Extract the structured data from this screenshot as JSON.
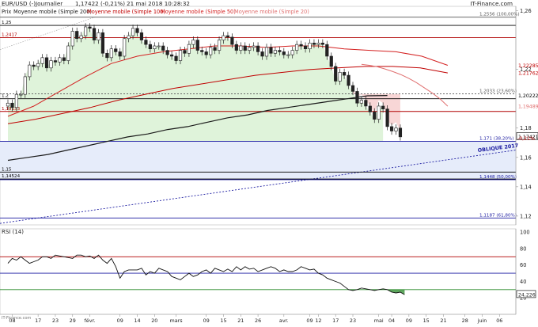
{
  "header": {
    "title": "EUR/USD (-)",
    "period": "Journalier",
    "last_change": "1,17422 (-0,21%)",
    "datetime": "21 mai 2018 10:28:32",
    "source": "IT-Finance.com"
  },
  "legend": [
    {
      "label": "Prix",
      "color": "#222222"
    },
    {
      "label": "Moyenne mobile (Simple 200)",
      "color": "#1a1a1a"
    },
    {
      "label": "Moyenne mobile (Simple 100)",
      "color": "#c00000"
    },
    {
      "label": "Moyenne mobile (Simple 50)",
      "color": "#d42020"
    },
    {
      "label": "Moyenne mobile (Simple 20)",
      "color": "#e07070"
    }
  ],
  "price_axis": {
    "ticks": [
      "1,26",
      "1,22",
      "1,18",
      "1,16",
      "1,14",
      "1,12"
    ],
    "tick_values": [
      1.26,
      1.22,
      1.18,
      1.16,
      1.14,
      1.12
    ],
    "range": [
      1.114,
      1.263
    ]
  },
  "rsi_axis": {
    "ticks": [
      "100",
      "80",
      "60",
      "40",
      "20"
    ],
    "tick_values": [
      100,
      80,
      60,
      40,
      20
    ],
    "range": [
      0,
      104
    ]
  },
  "x_axis": {
    "ticks": [
      "08",
      "17",
      "23",
      "29",
      "févr.",
      "09",
      "14",
      "20",
      "mars",
      "09",
      "15",
      "21",
      "26",
      "avr.",
      "09",
      "12",
      "17",
      "23",
      "mai",
      "04",
      "09",
      "15",
      "21",
      "28",
      "juin",
      "06"
    ],
    "tick_index": [
      1,
      7,
      11,
      15,
      19,
      26,
      30,
      34,
      39,
      46,
      50,
      54,
      58,
      64,
      70,
      72,
      76,
      80,
      86,
      89,
      93,
      97,
      101,
      106,
      110,
      114
    ]
  },
  "horizontal_levels": [
    {
      "value": 1.25,
      "label": "1,25",
      "color": "#000000",
      "side": "left"
    },
    {
      "value": 1.2556,
      "label": "1,2556 (100,00%)",
      "color": "#555555",
      "side": "right"
    },
    {
      "value": 1.2417,
      "label": "1,2417",
      "color": "#b00000",
      "side": "left"
    },
    {
      "value": 1.2033,
      "label": "1,2033 (23,60%)",
      "color": "#555555",
      "side": "right",
      "dashed": true
    },
    {
      "value": 1.2,
      "label": "1,2",
      "color": "#000000",
      "side": "left"
    },
    {
      "value": 1.19133,
      "label": "1,19133",
      "color": "#b00000",
      "side": "left"
    },
    {
      "value": 1.171,
      "label": "1,171 (38,20%)",
      "color": "#1a1aa0",
      "side": "right"
    },
    {
      "value": 1.15,
      "label": "1,15",
      "color": "#000000",
      "side": "left"
    },
    {
      "value": 1.14524,
      "label": "1,14524",
      "color": "#000000",
      "side": "left"
    },
    {
      "value": 1.1448,
      "label": "1,1448 (50,00%)",
      "color": "#1a1aa0",
      "side": "right"
    },
    {
      "value": 1.1187,
      "label": "1,1187 (61,80%)",
      "color": "#1a1aa0",
      "side": "right"
    }
  ],
  "value_badges": [
    {
      "value": 1.22285,
      "label": "1,22285",
      "color": "#c00000"
    },
    {
      "value": 1.21762,
      "label": "1,21762",
      "color": "#c00000"
    },
    {
      "value": 1.20222,
      "label": "1,20222",
      "color": "#000000"
    },
    {
      "value": 1.19489,
      "label": "1,19489",
      "color": "#e07070"
    },
    {
      "value": 1.17421,
      "label": "1,17421",
      "color": "#000000",
      "boxed": true
    }
  ],
  "change_label": "-0,21%",
  "oblique_label": "OBLIQUE 2017",
  "rsi": {
    "title": "RSI (14)",
    "value_label": "24,226",
    "levels": [
      {
        "value": 70,
        "color": "#b00000"
      },
      {
        "value": 50,
        "color": "#1a1aa0"
      },
      {
        "value": 30,
        "color": "#2a8a2a"
      }
    ],
    "values": [
      62,
      68,
      66,
      70,
      66,
      62,
      64,
      66,
      70,
      70,
      68,
      72,
      71,
      70,
      69,
      68,
      72,
      72,
      70,
      71,
      68,
      72,
      66,
      62,
      68,
      58,
      44,
      52,
      54,
      54,
      54,
      56,
      48,
      52,
      50,
      56,
      54,
      52,
      46,
      44,
      42,
      46,
      50,
      46,
      48,
      52,
      54,
      50,
      56,
      54,
      52,
      55,
      52,
      58,
      54,
      58,
      55,
      56,
      52,
      54,
      56,
      58,
      56,
      52,
      54,
      52,
      52,
      54,
      58,
      56,
      54,
      55,
      50,
      48,
      44,
      42,
      40,
      38,
      34,
      30,
      29,
      30,
      32,
      31,
      30,
      29,
      30,
      31,
      30,
      27,
      26,
      27,
      24
    ]
  },
  "chart_data": [
    {
      "type": "candlestick",
      "title": "EUR/USD (-)",
      "period": "Journalier",
      "ylim": [
        1.114,
        1.263
      ],
      "x_dates_approx": "08 janv. 2018 to 21 mai 2018 (trading days)",
      "closes": [
        1.197,
        1.194,
        1.203,
        1.203,
        1.215,
        1.223,
        1.222,
        1.224,
        1.228,
        1.221,
        1.226,
        1.225,
        1.228,
        1.226,
        1.236,
        1.246,
        1.241,
        1.243,
        1.249,
        1.248,
        1.24,
        1.245,
        1.231,
        1.228,
        1.234,
        1.232,
        1.229,
        1.241,
        1.243,
        1.248,
        1.245,
        1.24,
        1.237,
        1.234,
        1.236,
        1.236,
        1.233,
        1.23,
        1.229,
        1.226,
        1.233,
        1.231,
        1.237,
        1.24,
        1.233,
        1.232,
        1.23,
        1.235,
        1.233,
        1.24,
        1.243,
        1.242,
        1.237,
        1.233,
        1.236,
        1.233,
        1.235,
        1.236,
        1.232,
        1.229,
        1.235,
        1.231,
        1.233,
        1.232,
        1.23,
        1.23,
        1.233,
        1.237,
        1.236,
        1.234,
        1.238,
        1.237,
        1.238,
        1.237,
        1.229,
        1.222,
        1.212,
        1.218,
        1.216,
        1.209,
        1.205,
        1.197,
        1.199,
        1.195,
        1.191,
        1.186,
        1.195,
        1.193,
        1.181,
        1.178,
        1.18,
        1.174
      ]
    },
    {
      "type": "line",
      "series": [
        {
          "name": "Moyenne mobile (Simple 200)",
          "values": [
            1.158,
            1.16,
            1.162,
            1.165,
            1.168,
            1.171,
            1.174,
            1.176,
            1.179,
            1.181,
            1.184,
            1.187,
            1.189,
            1.192,
            1.194,
            1.196,
            1.198,
            1.2,
            1.202,
            1.2022
          ]
        },
        {
          "name": "Moyenne mobile (Simple 100)",
          "values": [
            1.183,
            1.186,
            1.19,
            1.194,
            1.199,
            1.203,
            1.207,
            1.21,
            1.213,
            1.216,
            1.218,
            1.22,
            1.221,
            1.222,
            1.222,
            1.221,
            1.2176
          ]
        },
        {
          "name": "Moyenne mobile (Simple 50)",
          "values": [
            1.188,
            1.195,
            1.205,
            1.215,
            1.224,
            1.229,
            1.232,
            1.234,
            1.236,
            1.236,
            1.235,
            1.236,
            1.236,
            1.234,
            1.233,
            1.232,
            1.229,
            1.2228
          ]
        },
        {
          "name": "Moyenne mobile (Simple 20)",
          "values": [
            1.2235,
            1.2228,
            1.2218,
            1.2203,
            1.2185,
            1.2165,
            1.214,
            1.211,
            1.2075,
            1.204,
            1.2,
            1.1949
          ]
        }
      ]
    }
  ]
}
